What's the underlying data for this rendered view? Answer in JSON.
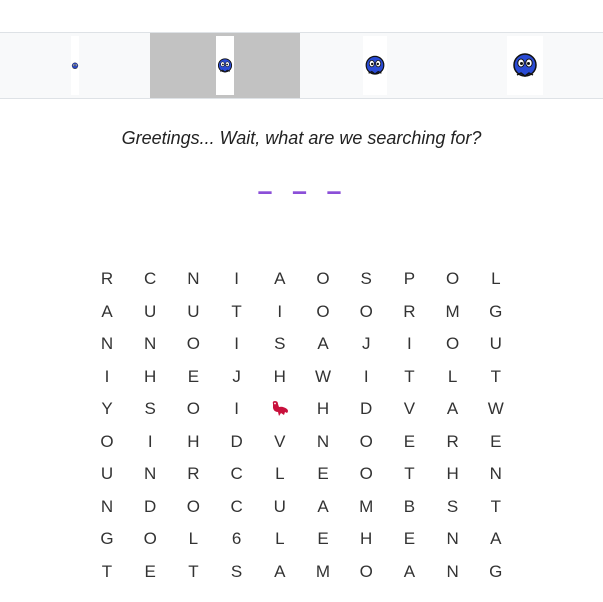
{
  "tabs": [
    {
      "name": "character-1",
      "active": false,
      "icon": "blue-character-icon"
    },
    {
      "name": "character-2",
      "active": true,
      "icon": "blue-character-icon"
    },
    {
      "name": "character-3",
      "active": false,
      "icon": "blue-character-icon"
    },
    {
      "name": "character-4",
      "active": false,
      "icon": "blue-character-icon"
    }
  ],
  "greeting": "Greetings... Wait, what are we searching for?",
  "word_blanks": "– – –",
  "colors": {
    "accent_purple": "#8b4fd8",
    "character_blue": "#2a4bd4",
    "marker_red": "#c8103c",
    "active_tab": "#c2c2c2"
  },
  "grid": {
    "rows": [
      [
        "R",
        "C",
        "N",
        "I",
        "A",
        "O",
        "S",
        "P",
        "O",
        "L"
      ],
      [
        "A",
        "U",
        "U",
        "T",
        "I",
        "O",
        "O",
        "R",
        "M",
        "G"
      ],
      [
        "N",
        "N",
        "O",
        "I",
        "S",
        "A",
        "J",
        "I",
        "O",
        "U"
      ],
      [
        "I",
        "H",
        "E",
        "J",
        "H",
        "W",
        "I",
        "T",
        "L",
        "T"
      ],
      [
        "Y",
        "S",
        "O",
        "I",
        "",
        "H",
        "D",
        "V",
        "A",
        "W"
      ],
      [
        "O",
        "I",
        "H",
        "D",
        "V",
        "N",
        "O",
        "E",
        "R",
        "E"
      ],
      [
        "U",
        "N",
        "R",
        "C",
        "L",
        "E",
        "O",
        "T",
        "H",
        "N"
      ],
      [
        "N",
        "D",
        "O",
        "C",
        "U",
        "A",
        "M",
        "B",
        "S",
        "T"
      ],
      [
        "G",
        "O",
        "L",
        "6",
        "L",
        "E",
        "H",
        "E",
        "N",
        "A"
      ],
      [
        "T",
        "E",
        "T",
        "S",
        "A",
        "M",
        "O",
        "A",
        "N",
        "G"
      ]
    ],
    "marker": {
      "row": 4,
      "col": 4,
      "icon": "red-bird-icon"
    }
  }
}
